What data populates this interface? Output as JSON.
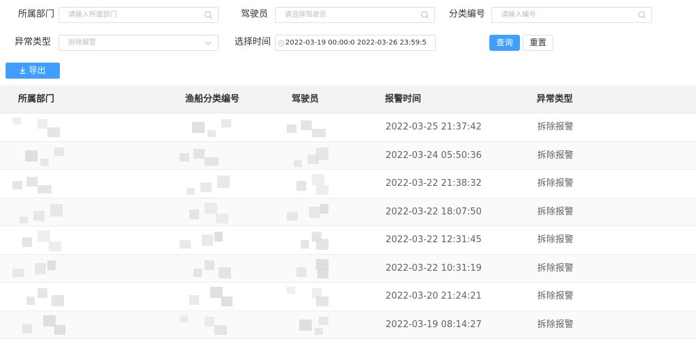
{
  "filters": {
    "department": {
      "label": "所属部门",
      "placeholder": "请输入所属部门"
    },
    "driver": {
      "label": "驾驶员",
      "placeholder": "请选择驾驶员"
    },
    "category_code": {
      "label": "分类编号",
      "placeholder": "请输入编号"
    },
    "abnormal_type": {
      "label": "异常类型",
      "placeholder": "拆除报警"
    },
    "time_range": {
      "label": "选择时间",
      "start": "2022-03-19 00:00:0",
      "separator": "-",
      "end": "2022-03-26 23:59:5"
    }
  },
  "buttons": {
    "query": "查询",
    "reset": "重置",
    "export": "导出"
  },
  "table": {
    "columns": [
      "所属部门",
      "渔船分类编号",
      "驾驶员",
      "报警时间",
      "异常类型"
    ],
    "rows": [
      {
        "alarm_time": "2022-03-25 21:37:42",
        "type": "拆除报警"
      },
      {
        "alarm_time": "2022-03-24 05:50:36",
        "type": "拆除报警"
      },
      {
        "alarm_time": "2022-03-22 21:38:32",
        "type": "拆除报警"
      },
      {
        "alarm_time": "2022-03-22 18:07:50",
        "type": "拆除报警"
      },
      {
        "alarm_time": "2022-03-22 12:31:45",
        "type": "拆除报警"
      },
      {
        "alarm_time": "2022-03-22 10:31:19",
        "type": "拆除报警"
      },
      {
        "alarm_time": "2022-03-20 21:24:21",
        "type": "拆除报警"
      },
      {
        "alarm_time": "2022-03-19 08:14:27",
        "type": "拆除报警"
      }
    ]
  },
  "colors": {
    "primary": "#409eff",
    "header_bg": "#f2f3f5",
    "border": "#dcdfe6"
  }
}
